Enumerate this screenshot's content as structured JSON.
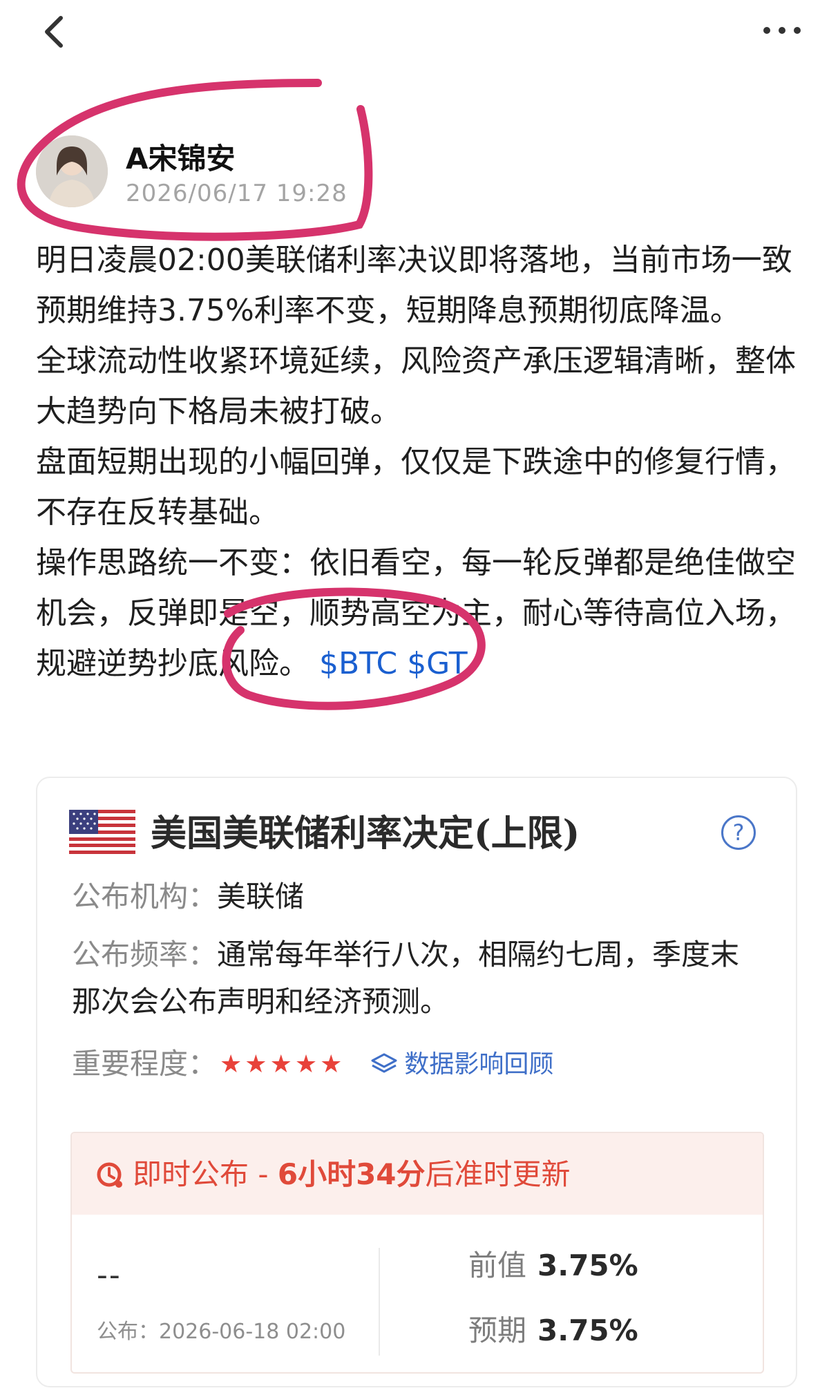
{
  "header": {
    "back_icon": "chevron-left-icon",
    "more_icon": "more-dots-icon"
  },
  "author": {
    "name": "A宋锦安",
    "time": "2026/06/17 19:28"
  },
  "post": {
    "paragraphs": [
      "明日凌晨02:00美联储利率决议即将落地，当前市场一致预期维持3.75%利率不变，短期降息预期彻底降温。",
      "全球流动性收紧环境延续，风险资产承压逻辑清晰，整体大趋势向下格局未被打破。",
      "盘面短期出现的小幅回弹，仅仅是下跌途中的修复行情，不存在反转基础。",
      "操作思路统一不变：依旧看空，每一轮反弹都是绝佳做空机会，反弹即是空，顺势高空为主，耐心等待高位入场，规避逆势抄底风险。"
    ],
    "tags": "$BTC $GT",
    "annotation_color": "#d6336c"
  },
  "card": {
    "title": "美国美联储利率决定(上限)",
    "issuer_label": "公布机构：",
    "issuer": "美联储",
    "freq_label": "公布频率：",
    "freq": "通常每年举行八次，相隔约七周，季度末那次会公布声明和经济预测。",
    "importance_label": "重要程度：",
    "stars": "★★★★★",
    "importance_level": 5,
    "review_link": "数据影响回顾",
    "release": {
      "mode": "即时公布 - ",
      "countdown": "6小时34分",
      "suffix": "后准时更新",
      "actual": "--",
      "pub_date": "公布：2026-06-18 02:00",
      "prev_label": "前值",
      "prev_value": "3.75%",
      "forecast_label": "预期",
      "forecast_value": "3.75%"
    },
    "accent": "#e04a3a",
    "link_color": "#3f6fc8"
  }
}
